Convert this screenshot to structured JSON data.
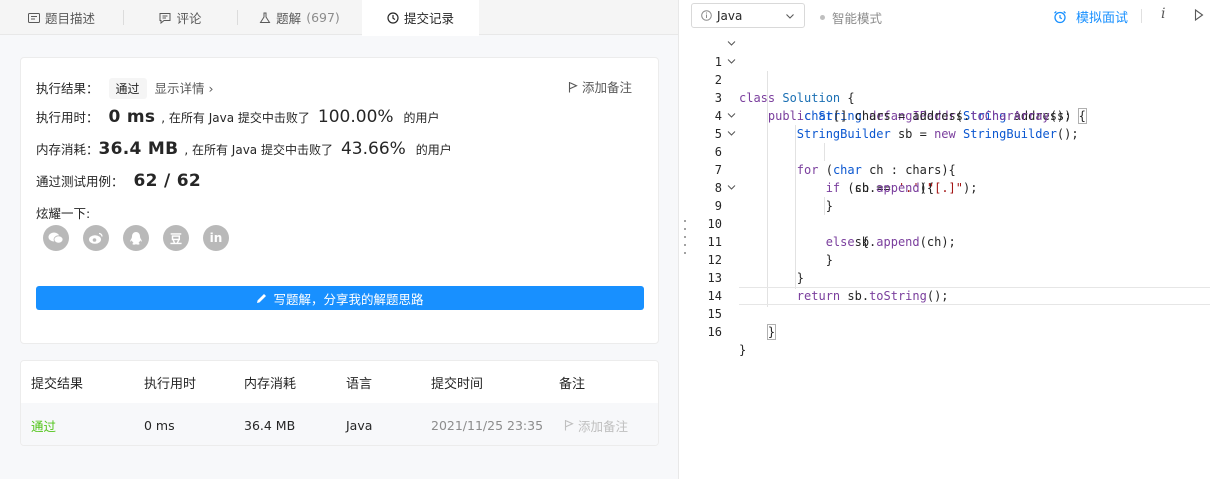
{
  "tabs": [
    {
      "label": "题目描述",
      "icon": "description-icon"
    },
    {
      "label": "评论",
      "icon": "comment-icon"
    },
    {
      "label": "题解",
      "count": "(697)",
      "icon": "flask-icon"
    },
    {
      "label": "提交记录",
      "icon": "clock-icon",
      "active": true
    }
  ],
  "result": {
    "label": "执行结果：",
    "status": "通过",
    "detail_link": "显示详情",
    "add_note": "添加备注",
    "runtime_label": "执行用时：",
    "runtime_value": "0 ms",
    "runtime_text": ", 在所有 Java 提交中击败了",
    "runtime_pct": "100.00%",
    "runtime_suffix": "的用户",
    "memory_label": "内存消耗：",
    "memory_value": "36.4 MB",
    "memory_text": ", 在所有 Java 提交中击败了",
    "memory_pct": "43.66%",
    "memory_suffix": "的用户",
    "tests_label": "通过测试用例：",
    "tests_value": "62 / 62",
    "share_label": "炫耀一下:",
    "share_buttons": [
      "wechat-icon",
      "weibo-icon",
      "qq-icon",
      "douban-icon",
      "linkedin-icon"
    ],
    "share_glyphs": [
      "豆",
      "in"
    ],
    "write_button": "写题解，分享我的解题思路"
  },
  "submissions": {
    "headers": [
      "提交结果",
      "执行用时",
      "内存消耗",
      "语言",
      "提交时间",
      "备注"
    ],
    "rows": [
      {
        "result": "通过",
        "runtime": "0 ms",
        "memory": "36.4 MB",
        "language": "Java",
        "time": "2021/11/25 23:35",
        "note": "添加备注"
      }
    ]
  },
  "toolbar": {
    "language": "Java",
    "smart_mode": "智能模式",
    "mock_interview": "模拟面试",
    "info": "i"
  },
  "editor": {
    "line_numbers": [
      "1",
      "2",
      "3",
      "4",
      "5",
      "6",
      "7",
      "8",
      "9",
      "10",
      "11",
      "12",
      "13",
      "14",
      "15",
      "16"
    ],
    "colors": {
      "keyword": "#7a3e9d",
      "type": "#0b57d0",
      "string": "#a31515",
      "accent": "#1890ff",
      "pass": "#52c41a"
    }
  }
}
